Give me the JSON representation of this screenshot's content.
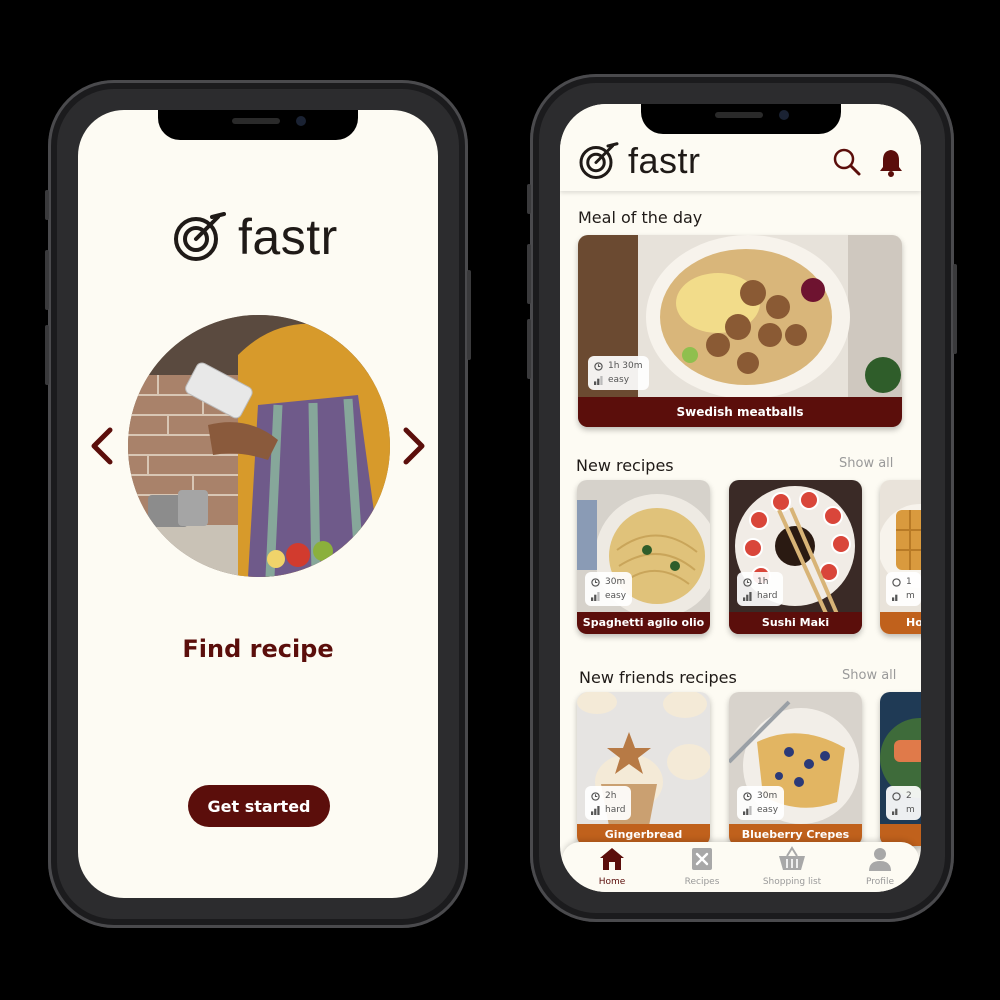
{
  "brand": {
    "name": "fastr",
    "accent": "#5b0e0b",
    "background": "#fdfbf3"
  },
  "onboarding": {
    "title": "Find recipe",
    "cta_label": "Get started",
    "prev_icon": "chevron-left-icon",
    "next_icon": "chevron-right-icon",
    "hero": "person-cooking-with-phone"
  },
  "home": {
    "header": {
      "search_icon": "search-icon",
      "bell_icon": "bell-icon"
    },
    "meal_of_day": {
      "title": "Meal of the day",
      "recipe": {
        "name": "Swedish meatballs",
        "time": "1h 30m",
        "difficulty": "easy"
      }
    },
    "new_recipes": {
      "title": "New recipes",
      "show_all": "Show all",
      "items": [
        {
          "name": "Spaghetti aglio olio",
          "time": "30m",
          "difficulty": "easy"
        },
        {
          "name": "Sushi Maki",
          "time": "1h",
          "difficulty": "hard"
        },
        {
          "name": "Ho",
          "time": "1",
          "difficulty": "m"
        }
      ]
    },
    "friends_recipes": {
      "title": "New friends recipes",
      "show_all": "Show all",
      "items": [
        {
          "name": "Gingerbread cupcakes",
          "time": "2h",
          "difficulty": "hard"
        },
        {
          "name": "Blueberry Crepes",
          "time": "30m",
          "difficulty": "easy"
        },
        {
          "name": "",
          "time": "2",
          "difficulty": "m"
        }
      ]
    },
    "tabs": [
      {
        "label": "Home",
        "icon": "home-icon",
        "active": true
      },
      {
        "label": "Recipes",
        "icon": "recipes-icon",
        "active": false
      },
      {
        "label": "Shopping list",
        "icon": "basket-icon",
        "active": false
      },
      {
        "label": "Profile",
        "icon": "profile-icon",
        "active": false
      }
    ]
  }
}
